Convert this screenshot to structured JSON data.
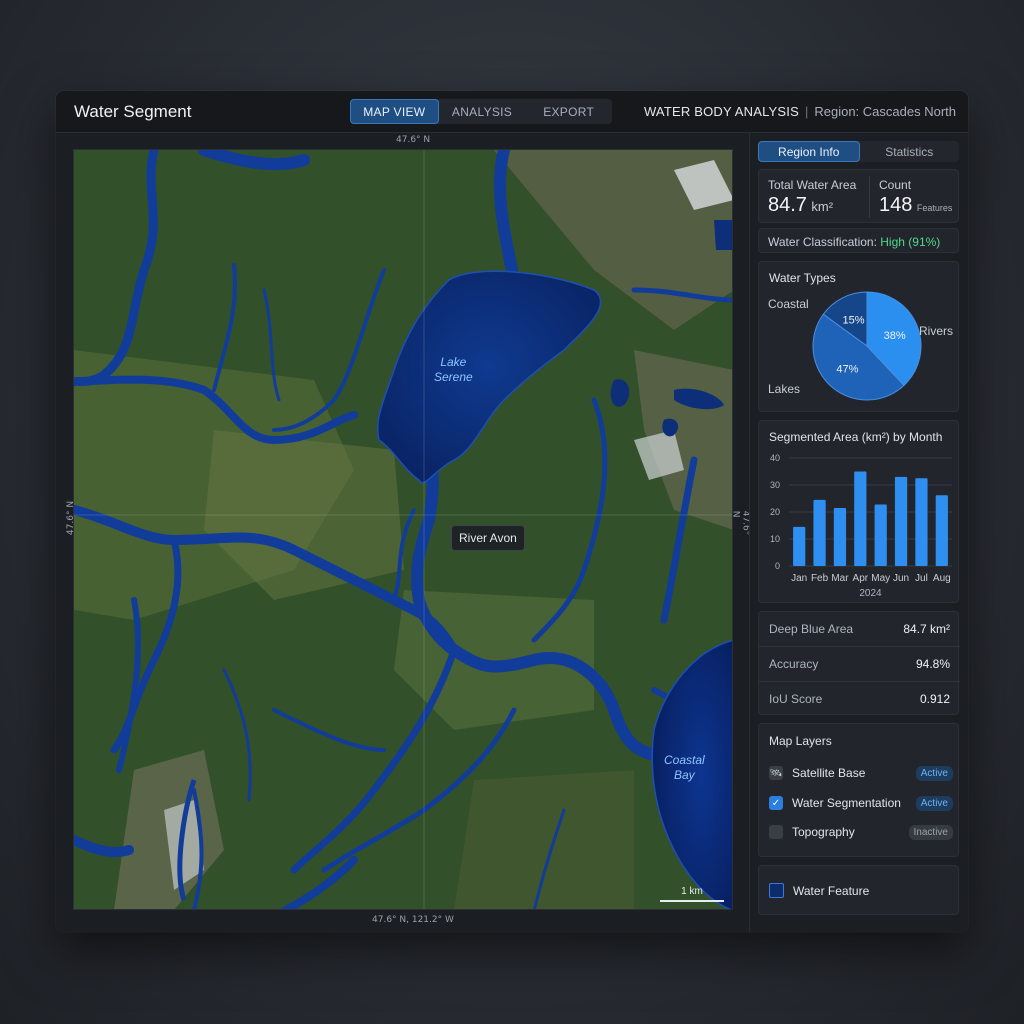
{
  "header": {
    "app_title": "Water Segment",
    "tabs": [
      "MAP VIEW",
      "ANALYSIS",
      "EXPORT"
    ],
    "active_tab": "MAP VIEW",
    "analysis_title": "WATER BODY ANALYSIS",
    "separator": "|",
    "region": "Region: Cascades North"
  },
  "map": {
    "coord_top": "47.6° N",
    "coord_bottom": "47.6° N, 121.2° W",
    "coord_left": "47.6° N",
    "coord_right": "47.6° N",
    "lake_label_1": "Lake",
    "lake_label_2": "Serene",
    "river_label": "River Avon",
    "bay_label_1": "Coastal",
    "bay_label_2": "Bay",
    "scale_label": "1 km"
  },
  "panel": {
    "tabs": [
      "Region Info",
      "Statistics"
    ],
    "active_tab": "Region Info",
    "total_area_label": "Total Water Area",
    "total_area_value": "84.7",
    "total_area_unit": "km²",
    "count_label": "Count",
    "count_value": "148",
    "count_unit": "Features",
    "classification_label": "Water Classification:",
    "classification_value": "High (91%)",
    "water_types_title": "Water Types",
    "segmented_title": "Segmented Area (km²) by Month",
    "metrics": [
      {
        "label": "Deep Blue Area",
        "value": "84.7 km²"
      },
      {
        "label": "Accuracy",
        "value": "94.8%"
      },
      {
        "label": "IoU Score",
        "value": "0.912"
      }
    ],
    "layers_title": "Map Layers",
    "layers": [
      {
        "name": "Satellite Base",
        "status": "Active",
        "icon": "satellite-icon"
      },
      {
        "name": "Water Segmentation",
        "status": "Active",
        "icon": "checkmark-icon"
      },
      {
        "name": "Topography",
        "status": "Inactive",
        "icon": "empty-checkbox"
      }
    ],
    "legend_label": "Water Feature"
  },
  "colors": {
    "accent": "#1f4f82",
    "accent_border": "#3b78b8",
    "classification_green": "#4fd88a",
    "bar_blue": "#2f8ff0",
    "water_deep": "#0d2c6e"
  },
  "chart_data": [
    {
      "type": "pie",
      "title": "Water Types",
      "labels": [
        "Rivers",
        "Lakes",
        "Coastal"
      ],
      "values": [
        38,
        47,
        15
      ],
      "value_labels": [
        "38%",
        "47%",
        "15%"
      ],
      "colors": [
        "#2b8fef",
        "#1e63b8",
        "#16468a"
      ]
    },
    {
      "type": "bar",
      "title": "Segmented Area (km²) by Month",
      "categories": [
        "Jan",
        "Feb",
        "Mar",
        "Apr",
        "May",
        "Jun",
        "Jul",
        "Aug"
      ],
      "values": [
        14.5,
        24.5,
        21.5,
        35,
        22.8,
        33,
        32.5,
        26.2
      ],
      "xlabel": "2024",
      "ylabel": "",
      "ylim": [
        0,
        40
      ],
      "yticks": [
        0,
        10,
        20,
        30,
        40
      ],
      "grid": true
    }
  ]
}
